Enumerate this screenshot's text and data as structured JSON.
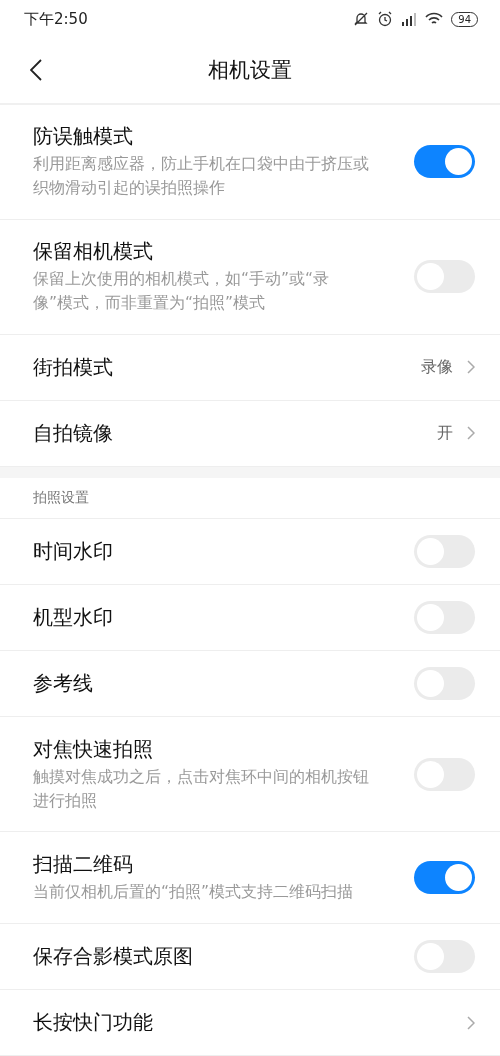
{
  "status_bar": {
    "time": "下午2:50",
    "battery": "94"
  },
  "header": {
    "title": "相机设置"
  },
  "sections": [
    {
      "items": [
        {
          "kind": "toggle",
          "title": "防误触模式",
          "description": "利用距离感应器，防止手机在口袋中由于挤压或织物滑动引起的误拍照操作",
          "on": true
        },
        {
          "kind": "toggle",
          "title": "保留相机模式",
          "description": "保留上次使用的相机模式，如“手动”或“录像”模式，而非重置为“拍照”模式",
          "on": false
        },
        {
          "kind": "link",
          "title": "街拍模式",
          "value": "录像"
        },
        {
          "kind": "link",
          "title": "自拍镜像",
          "value": "开"
        }
      ]
    },
    {
      "header": "拍照设置",
      "items": [
        {
          "kind": "toggle",
          "title": "时间水印",
          "on": false
        },
        {
          "kind": "toggle",
          "title": "机型水印",
          "on": false
        },
        {
          "kind": "toggle",
          "title": "参考线",
          "on": false
        },
        {
          "kind": "toggle",
          "title": "对焦快速拍照",
          "description": "触摸对焦成功之后，点击对焦环中间的相机按钮进行拍照",
          "on": false
        },
        {
          "kind": "toggle",
          "title": "扫描二维码",
          "description": "当前仅相机后置的“拍照”模式支持二维码扫描",
          "on": true
        },
        {
          "kind": "toggle",
          "title": "保存合影模式原图",
          "on": false
        },
        {
          "kind": "link",
          "title": "长按快门功能"
        }
      ]
    }
  ]
}
